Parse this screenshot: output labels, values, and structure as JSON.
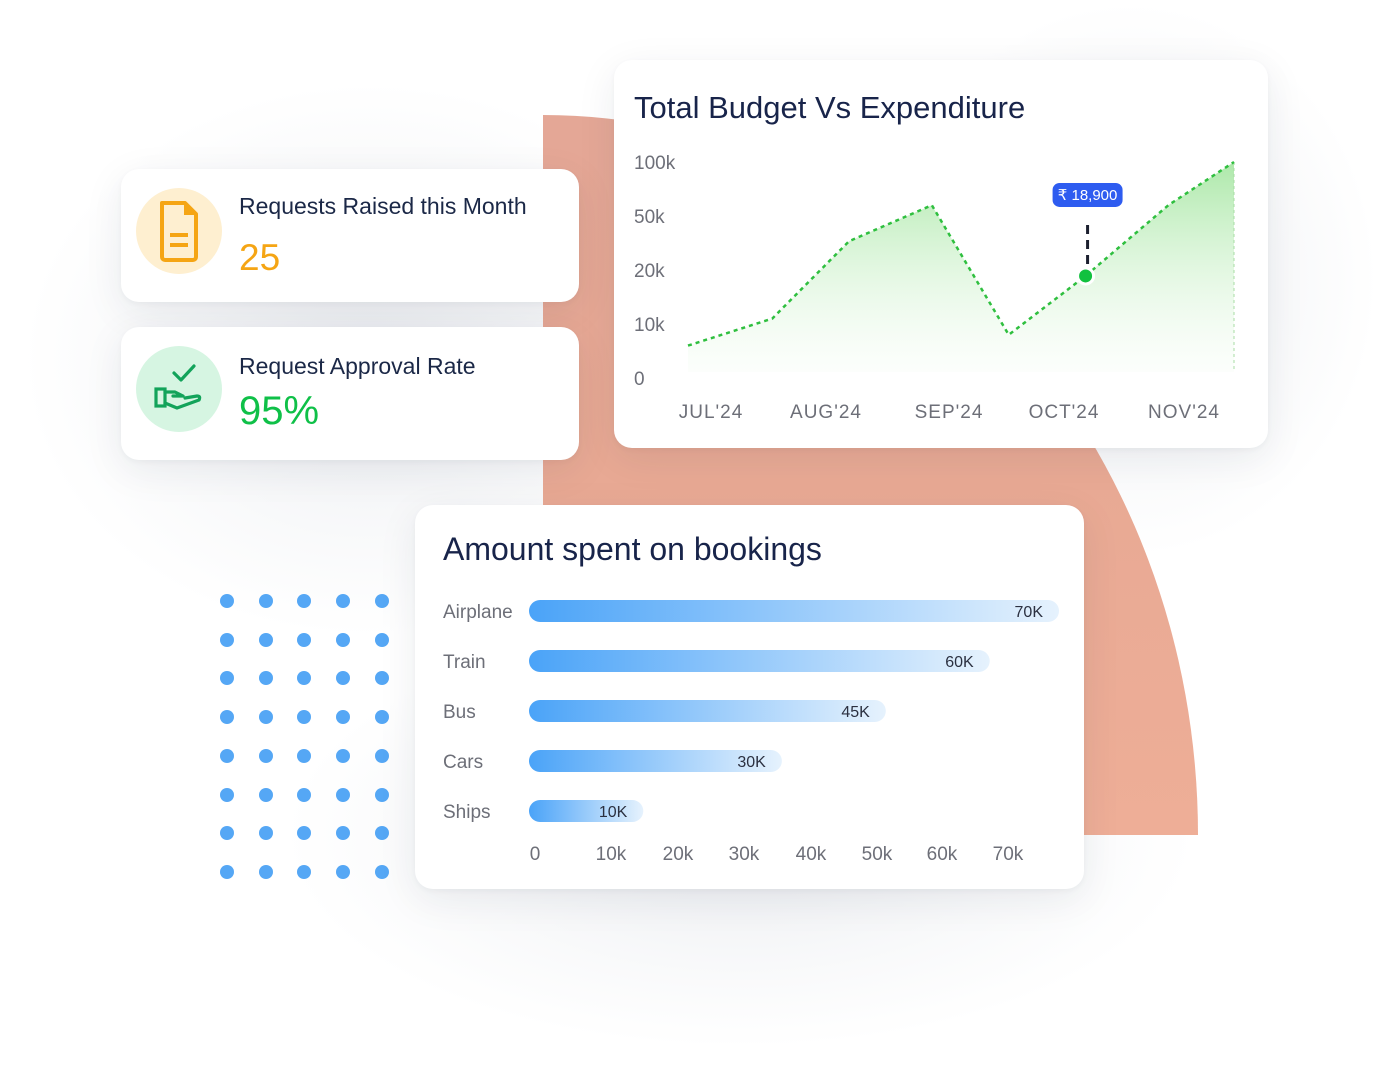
{
  "kpis": [
    {
      "label": "Requests Raised this Month",
      "value": "25",
      "icon": "document-icon",
      "color": "#f5a514"
    },
    {
      "label": "Request Approval Rate",
      "value": "95%",
      "icon": "hand-check-icon",
      "color": "#0fc048"
    }
  ],
  "colors": {
    "accent_blue": "#55a7f5",
    "line_green": "#2fbf3f",
    "tooltip_blue": "#2e5cf0",
    "background_shape": "#e8a994"
  },
  "chart_data": [
    {
      "type": "area",
      "title": "Total Budget Vs Expenditure",
      "categories": [
        "JUL'24",
        "AUG'24",
        "SEP'24",
        "OCT'24",
        "NOV'24"
      ],
      "y_ticks": [
        "100k",
        "50k",
        "20k",
        "10k",
        "0"
      ],
      "y_tick_values": [
        100000,
        50000,
        20000,
        10000,
        0
      ],
      "y_scale": "categorical-ticks",
      "series": [
        {
          "name": "Expenditure",
          "x": [
            0.0,
            0.33,
            0.67,
            1.0,
            1.33,
            1.67,
            2.0,
            2.33,
            2.67,
            3.0,
            3.33,
            3.67,
            4.0,
            4.33
          ],
          "points_x": [
            -0.2,
            0.45,
            1.1,
            1.8,
            2.45,
            3.1,
            3.8,
            4.45
          ],
          "values": [
            6000,
            11000,
            36000,
            60000,
            8000,
            18900,
            60000,
            100000
          ]
        }
      ],
      "highlight": {
        "index": 5,
        "category": "OCT'24",
        "label": "₹ 18,900",
        "value": 18900
      },
      "grid": false,
      "legend": "none"
    },
    {
      "type": "bar",
      "orientation": "horizontal",
      "title": "Amount spent on bookings",
      "categories": [
        "Airplane",
        "Train",
        "Bus",
        "Cars",
        "Ships"
      ],
      "values": [
        70000,
        60000,
        45000,
        30000,
        10000
      ],
      "value_labels": [
        "70K",
        "60K",
        "45K",
        "30K",
        "10K"
      ],
      "x_ticks": [
        "0",
        "10k",
        "20k",
        "30k",
        "40k",
        "50k",
        "60k",
        "70k"
      ],
      "xlim": [
        0,
        70000
      ],
      "grid": false,
      "legend": "none"
    }
  ]
}
